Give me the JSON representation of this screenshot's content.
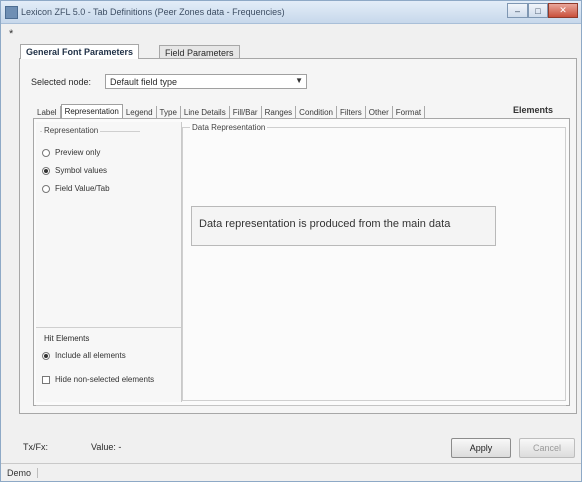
{
  "window": {
    "title": "Lexicon ZFL 5.0 - Tab Definitions (Peer Zones data - Frequencies)",
    "minimize_label": "‒",
    "maximize_label": "□",
    "close_label": "✕"
  },
  "toolbar": {
    "marker": "*"
  },
  "outer_tabs": [
    {
      "label": "General Font Parameters"
    },
    {
      "label": "Field Parameters"
    }
  ],
  "selected_node": {
    "label": "Selected node:",
    "value": "Default field type"
  },
  "inner_tabs": [
    {
      "label": "Label"
    },
    {
      "label": "Representation"
    },
    {
      "label": "Legend"
    },
    {
      "label": "Type"
    },
    {
      "label": "Line Details"
    },
    {
      "label": "Fill/Bar"
    },
    {
      "label": "Ranges"
    },
    {
      "label": "Condition"
    },
    {
      "label": "Filters"
    },
    {
      "label": "Other"
    },
    {
      "label": "Format"
    }
  ],
  "elements_label": "Elements",
  "left_panel": {
    "group_label": "Representation",
    "options": [
      {
        "label": "Preview only"
      },
      {
        "label": "Symbol values"
      },
      {
        "label": "Field Value/Tab"
      }
    ],
    "hit_label": "Hit Elements",
    "hit_options": [
      {
        "label": "Include all elements"
      },
      {
        "label": "Hide non-selected elements"
      }
    ]
  },
  "right_panel": {
    "group_label": "Data Representation",
    "message": "Data representation is produced from the main data"
  },
  "footer": {
    "type_label": "Tx/Fx:",
    "value_label": "Value: -",
    "apply_label": "Apply",
    "cancel_label": "Cancel"
  },
  "status": {
    "text": "Demo"
  }
}
